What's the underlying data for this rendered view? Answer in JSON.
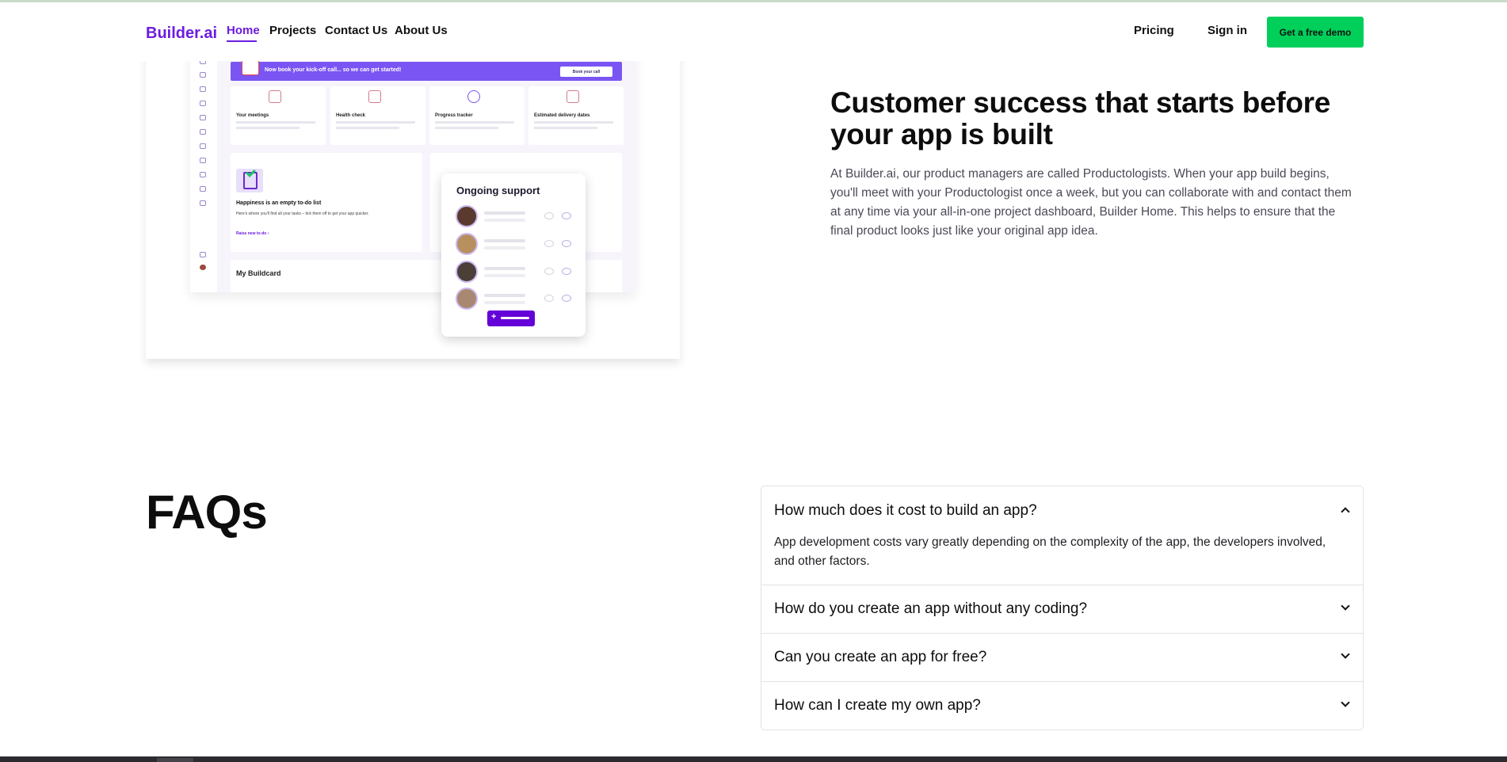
{
  "nav": {
    "logo": "Builder.ai",
    "links": [
      "Home",
      "Projects",
      "Contact Us",
      "About Us"
    ],
    "pricing": "Pricing",
    "signin": "Sign in",
    "demo": "Get a free demo",
    "accent": "#6c1ce0",
    "demo_color": "#00d05a"
  },
  "mockup": {
    "banner_text": "Now book your kick-off call... so we can get started!",
    "banner_button": "Book your call",
    "tiles": [
      {
        "title": "Your meetings",
        "icon": "calendar-icon"
      },
      {
        "title": "Health check",
        "icon": "bar-chart-icon"
      },
      {
        "title": "Progress tracker",
        "icon": "progress-ring-icon"
      },
      {
        "title": "Estimated delivery dates",
        "icon": "calendar-clock-icon"
      }
    ],
    "todo_title": "Happiness is an empty to-do list",
    "todo_desc": "Here's where you'll find all your tasks – tick them off to get your app quicker.",
    "todo_link": "Raise new to-do  ›",
    "buildcard": "My Buildcard",
    "support_title": "Ongoing support",
    "support_rows": 4
  },
  "section": {
    "title": "Customer success that starts before your app is built",
    "body": "At Builder.ai, our product managers are called Productologists. When your app build begins, you'll meet with your Productologist once a week, but you can collaborate with and contact them at any time via your all-in-one project dashboard, Builder Home. This helps to ensure that the final product looks just like your original app idea."
  },
  "faq": {
    "title": "FAQs",
    "items": [
      {
        "question": "How much does it cost to build an app?",
        "answer": "App development costs vary greatly depending on the complexity of the app, the developers involved, and other factors.",
        "expanded": true
      },
      {
        "question": "How do you create an app without any coding?",
        "expanded": false
      },
      {
        "question": "Can you create an app for free?",
        "expanded": false
      },
      {
        "question": "How can I create my own app?",
        "expanded": false
      }
    ]
  }
}
